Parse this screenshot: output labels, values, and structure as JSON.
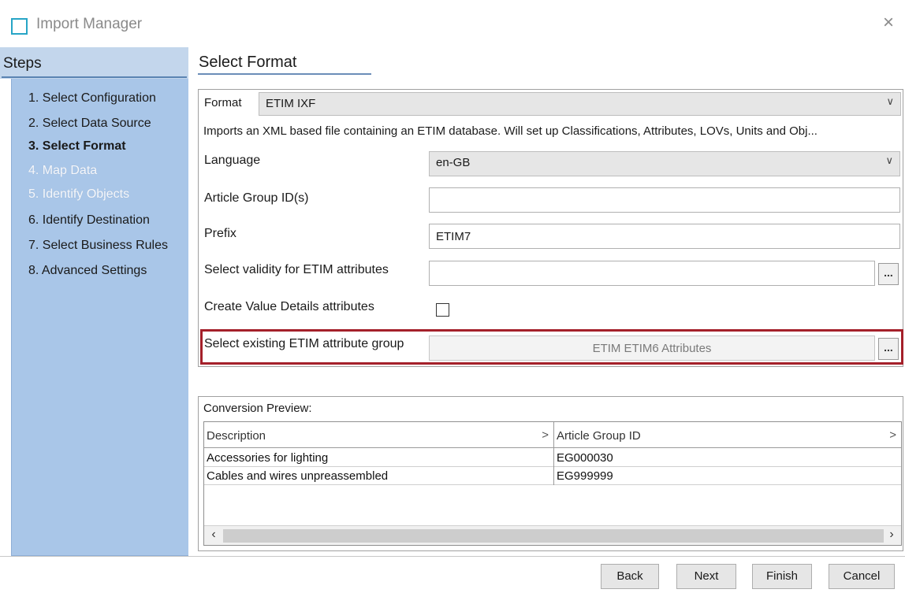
{
  "window": {
    "title": "Import Manager",
    "close_glyph": "×",
    "icon": "window-icon"
  },
  "steps": {
    "title": "Steps",
    "items": [
      {
        "label": "1. Select Configuration",
        "state": "normal"
      },
      {
        "label": "2. Select Data Source",
        "state": "normal"
      },
      {
        "label": "3. Select Format",
        "state": "active"
      },
      {
        "label": "4. Map Data",
        "state": "disabled"
      },
      {
        "label": "5. Identify Objects",
        "state": "disabled"
      },
      {
        "label": "6. Identify Destination",
        "state": "normal"
      },
      {
        "label": "7. Select Business Rules",
        "state": "normal"
      },
      {
        "label": "8. Advanced Settings",
        "state": "normal"
      }
    ]
  },
  "section": {
    "title": "Select Format"
  },
  "format": {
    "label": "Format",
    "value": "ETIM IXF",
    "description": "Imports an XML based file containing an ETIM database. Will set up Classifications, Attributes, LOVs, Units and Obj..."
  },
  "form": {
    "language_label": "Language",
    "language_value": "en-GB",
    "article_group_label": "Article Group ID(s)",
    "article_group_value": "",
    "prefix_label": "Prefix",
    "prefix_value": "ETIM7",
    "validity_label": "Select validity for ETIM attributes",
    "validity_value": "",
    "value_details_label": "Create Value Details attributes",
    "value_details_checked": false,
    "attr_group_label": "Select existing ETIM attribute group",
    "attr_group_value": "ETIM ETIM6 Attributes",
    "browse_label": "..."
  },
  "preview": {
    "title": "Conversion Preview:",
    "columns": [
      "Description",
      "Article Group ID"
    ],
    "rows": [
      [
        "Accessories for lighting",
        "EG000030"
      ],
      [
        "Cables and wires unpreassembled",
        "EG999999"
      ]
    ],
    "sort_glyph": ">"
  },
  "footer": {
    "back": "Back",
    "next": "Next",
    "finish": "Finish",
    "cancel": "Cancel"
  },
  "colors": {
    "accent_border": "#a4202a",
    "steps_bg": "#a9c6e8",
    "steps_header_bg": "#c3d6ec"
  }
}
